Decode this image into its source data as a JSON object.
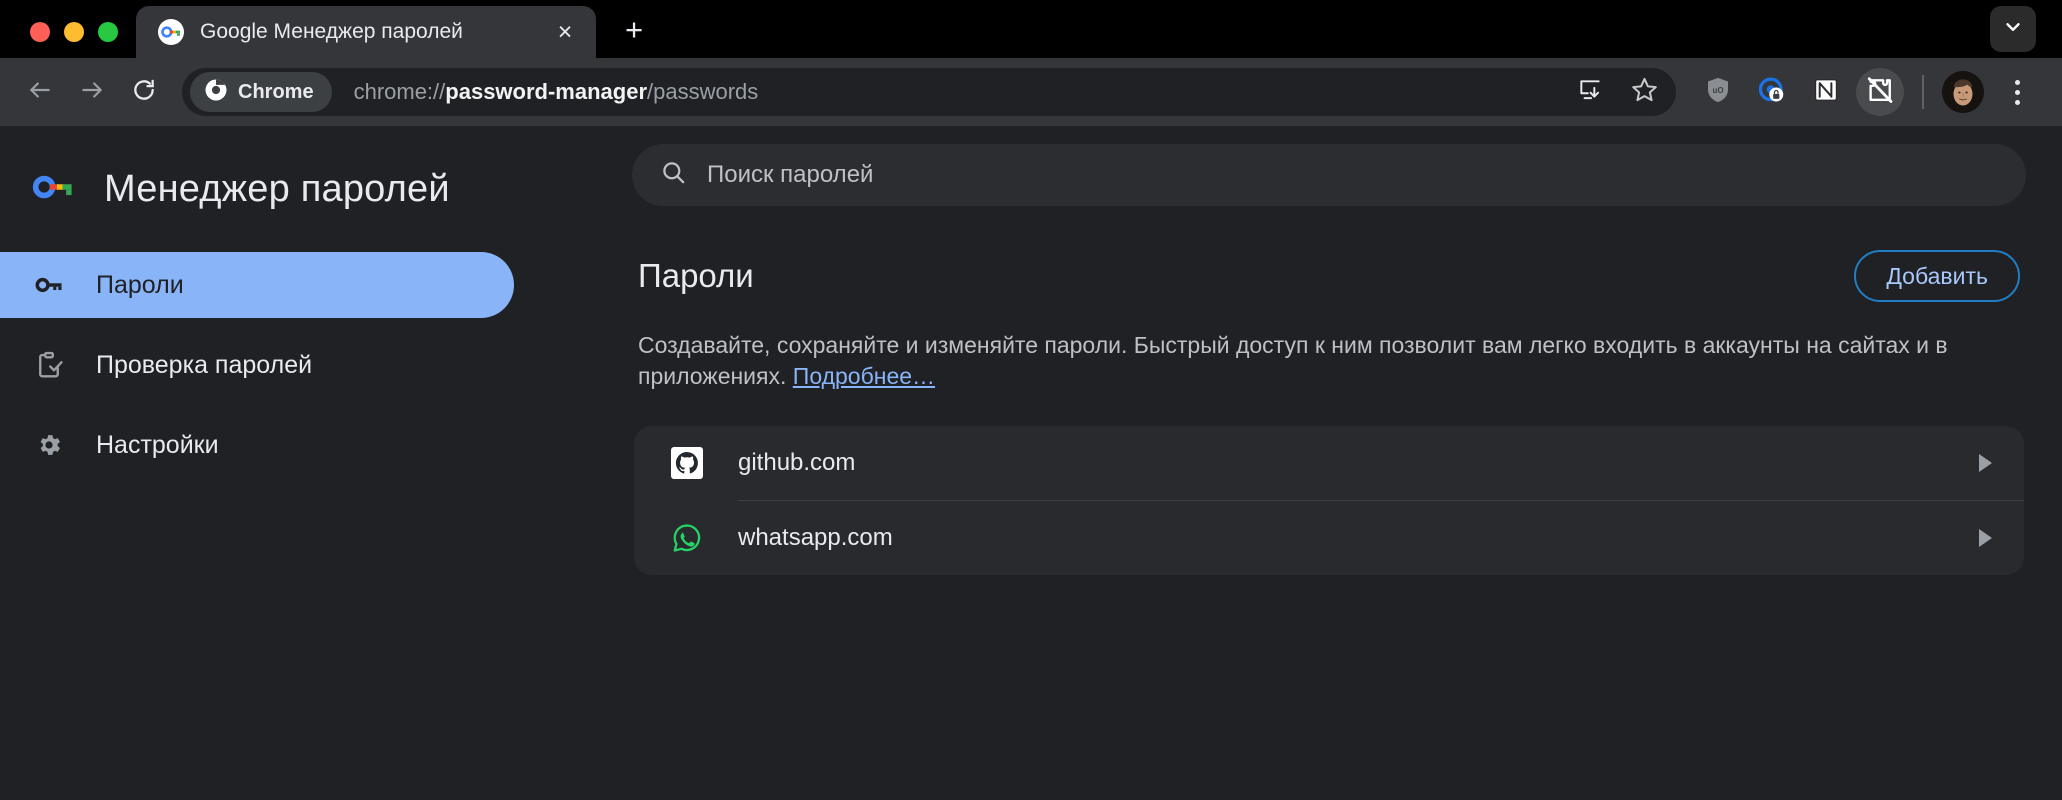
{
  "window": {
    "traffic_lights": [
      "close",
      "minimize",
      "maximize"
    ]
  },
  "tabstrip": {
    "tab": {
      "title": "Google Менеджер паролей",
      "favicon": "google-password-manager-key-icon",
      "close_label": "×"
    },
    "new_tab_label": "+",
    "tab_search_icon": "chevron-down-icon"
  },
  "toolbar": {
    "back_icon": "back-arrow-icon",
    "forward_icon": "forward-arrow-icon",
    "reload_icon": "reload-icon",
    "chrome_chip_label": "Chrome",
    "url_prefix": "chrome://",
    "url_bold": "password-manager",
    "url_suffix": "/passwords",
    "install_icon": "install-app-icon",
    "bookmark_icon": "star-icon",
    "extensions": [
      {
        "name": "ublock-origin-icon",
        "label": "uO"
      },
      {
        "name": "password-lock-extension-icon",
        "label": ""
      },
      {
        "name": "notion-extension-icon",
        "label": "N"
      },
      {
        "name": "extensions-blocked-icon",
        "label": ""
      }
    ],
    "avatar_name": "avatar",
    "menu_icon": "three-dot-menu-icon"
  },
  "sidebar": {
    "brand_icon": "google-password-manager-key-icon",
    "brand_title": "Менеджер паролей",
    "items": [
      {
        "label": "Пароли",
        "icon": "key-icon",
        "selected": true
      },
      {
        "label": "Проверка паролей",
        "icon": "clipboard-check-icon",
        "selected": false
      },
      {
        "label": "Настройки",
        "icon": "gear-icon",
        "selected": false
      }
    ]
  },
  "search": {
    "icon": "search-icon",
    "placeholder": "Поиск паролей",
    "value": ""
  },
  "main": {
    "title": "Пароли",
    "add_button": "Добавить",
    "description": "Создавайте, сохраняйте и изменяйте пароли. Быстрый доступ к ним позволит вам легко входить в аккаунты на сайтах и в приложениях. ",
    "description_link": "Подробнее…",
    "entries": [
      {
        "site": "github.com",
        "icon": "github-icon",
        "chevron": "chevron-right-icon"
      },
      {
        "site": "whatsapp.com",
        "icon": "whatsapp-icon",
        "chevron": "chevron-right-icon"
      }
    ]
  },
  "colors": {
    "accent": "#8AB4F8",
    "page_bg": "#202124",
    "card_bg": "#292A2D",
    "toolbar_bg": "#35363A"
  }
}
